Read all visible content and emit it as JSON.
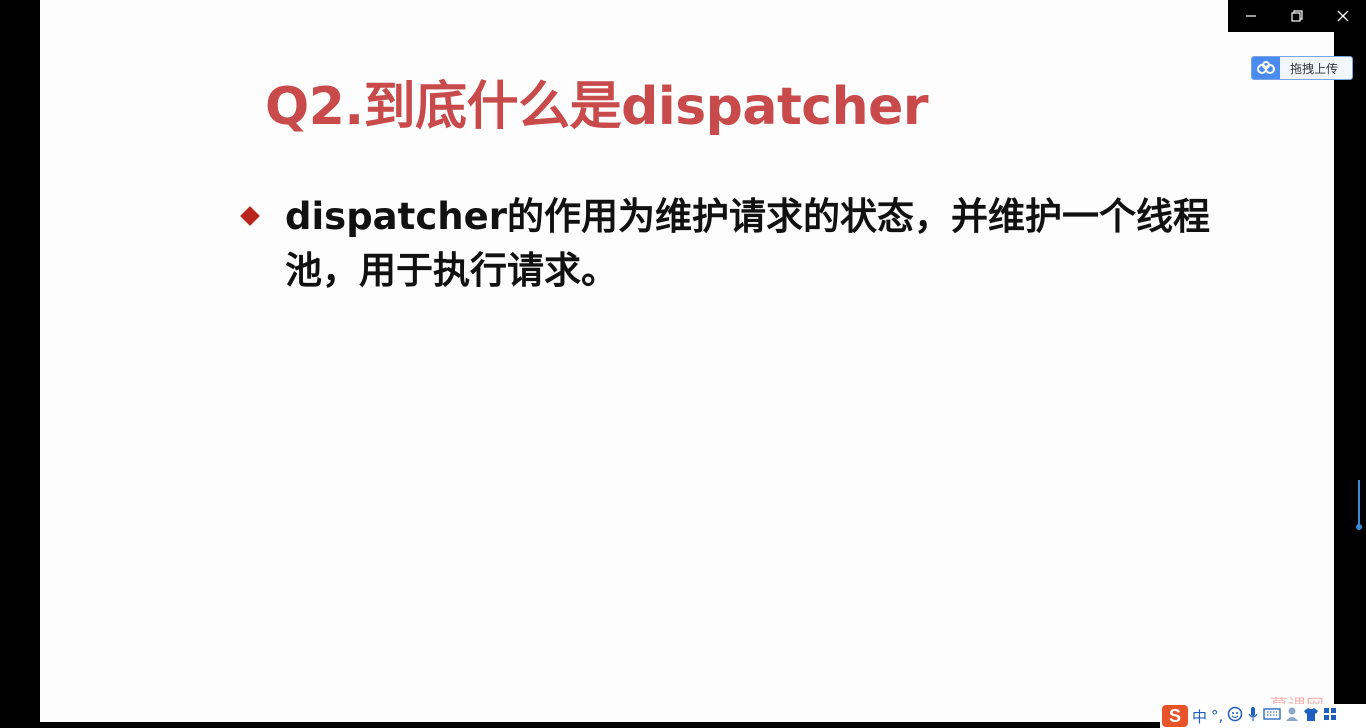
{
  "slide": {
    "title": "Q2.到底什么是dispatcher",
    "bullet": "dispatcher的作用为维护请求的状态，并维护一个线程池，用于执行请求。",
    "watermark": "慕课网"
  },
  "window_controls": {
    "icons": [
      "minimize-icon",
      "restore-icon",
      "close-icon"
    ]
  },
  "baidu_widget": {
    "label": "拖拽上传",
    "icon": "baidu-cloud-icon"
  },
  "ime_toolbar": {
    "logo": "S",
    "mode": "中",
    "punct": "°,",
    "icons": [
      "emoji-icon",
      "microphone-icon",
      "keyboard-icon",
      "user-icon",
      "shirt-icon",
      "grid-icon"
    ]
  },
  "colors": {
    "title": "#c84a4a",
    "bullet_marker": "#b8251c",
    "ime_logo": "#e8532a",
    "accent_blue": "#3a8bd8"
  }
}
